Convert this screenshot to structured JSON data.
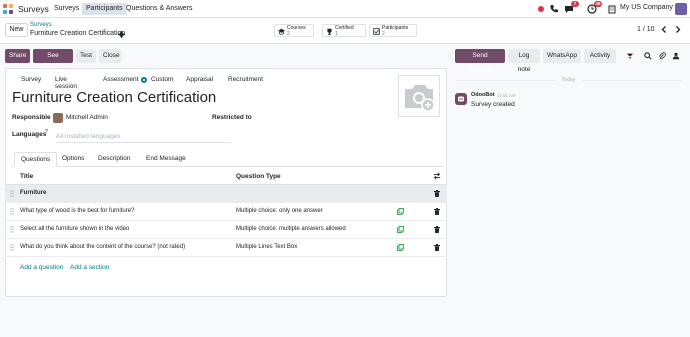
{
  "navbar": {
    "brand": "Surveys",
    "menu": [
      "Surveys",
      "Participants",
      "Questions & Answers"
    ],
    "active_menu": "Participants",
    "badges": {
      "chat": "7",
      "activity": "45"
    },
    "company": "My US Company"
  },
  "control": {
    "new_label": "New",
    "breadcrumb_parent": "Surveys",
    "breadcrumb_current": "Furniture Creation Certification",
    "stats": [
      {
        "label": "Courses",
        "value": "2"
      },
      {
        "label": "Certified",
        "value": "1"
      },
      {
        "label": "Participants",
        "value": "2"
      }
    ],
    "pager": "1 / 10"
  },
  "actions": {
    "share": "Share",
    "see_results": "See results",
    "test": "Test",
    "close": "Close"
  },
  "chatter": {
    "send_message": "Send message",
    "log_note": "Log note",
    "whatsapp": "WhatsApp",
    "activity": "Activity",
    "date_separator": "Today",
    "messages": [
      {
        "author": "OdooBot",
        "time": "11:51 AM",
        "body": "Survey created"
      }
    ]
  },
  "form": {
    "survey_types": [
      "Survey",
      "Live session",
      "Assessment",
      "Custom",
      "Appraisal",
      "Recruitment"
    ],
    "selected_type": "Custom",
    "title": "Furniture Creation Certification",
    "responsible_label": "Responsible",
    "responsible_value": "Mitchell Admin",
    "restricted_label": "Restricted to",
    "languages_label": "Languages",
    "languages_placeholder": "All installed languages",
    "tabs": [
      "Questions",
      "Options",
      "Description",
      "End Message"
    ],
    "active_tab": "Questions"
  },
  "table": {
    "columns": [
      "Title",
      "Question Type"
    ],
    "section": "Furniture",
    "rows": [
      {
        "title": "What type of wood is the best for furniture?",
        "type": "Multiple choice: only one answer"
      },
      {
        "title": "Select all the furniture shown in the video",
        "type": "Multiple choice: multiple answers allowed"
      },
      {
        "title": "What do you think about the content of the course? (not rated)",
        "type": "Multiple Lines Text Box"
      }
    ],
    "add_question": "Add a question",
    "add_section": "Add a section"
  },
  "colors": {
    "brand": "#714b67",
    "accent": "#017e84",
    "badge": "#dc3545"
  }
}
